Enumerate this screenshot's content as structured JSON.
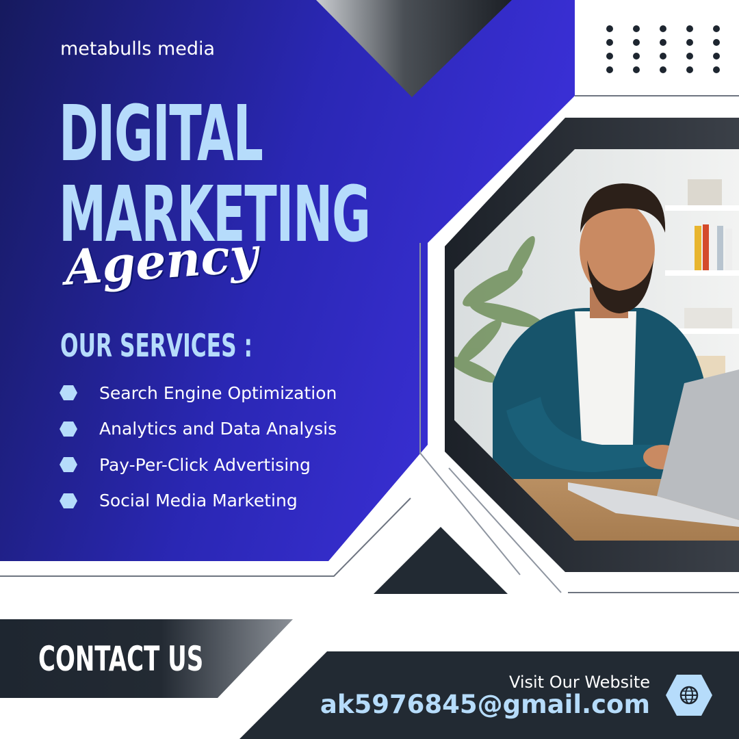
{
  "brand": {
    "name": "metabulls media"
  },
  "hero": {
    "line1": "DIGITAL",
    "line2": "MARKETING",
    "script": "Agency"
  },
  "services": {
    "title": "OUR SERVICES :",
    "items": [
      "Search Engine Optimization",
      "Analytics and Data Analysis",
      "Pay-Per-Click Advertising",
      "Social Media Marketing"
    ]
  },
  "contact": {
    "title": "CONTACT US",
    "website_label": "Visit Our Website",
    "email": "ak5976845@gmail.com"
  },
  "icons": {
    "bullet": "hexagon-icon",
    "website": "globe-icon",
    "photo": "man-at-laptop-photo"
  },
  "colors": {
    "primary_blue_dark": "#1a1e6e",
    "primary_blue_light": "#3a2fd6",
    "accent_light_blue": "#b6dcfb",
    "charcoal": "#222a33",
    "white": "#ffffff"
  }
}
